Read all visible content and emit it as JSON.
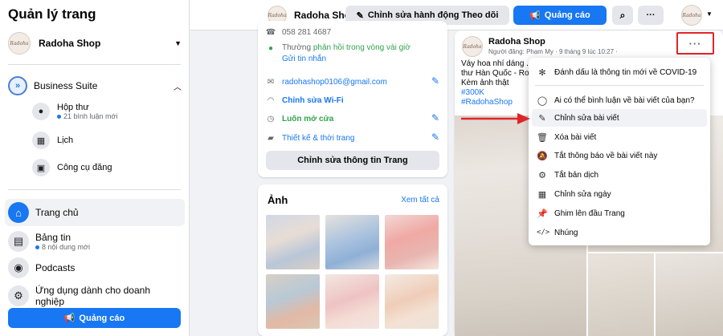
{
  "sidebar": {
    "title": "Quản lý trang",
    "page_name": "Radoha Shop",
    "business_suite": "Business Suite",
    "items": [
      {
        "label": "Hộp thư",
        "sub": "21 bình luận mới"
      },
      {
        "label": "Lịch",
        "sub": ""
      },
      {
        "label": "Công cụ đăng",
        "sub": ""
      }
    ],
    "nav": [
      {
        "label": "Trang chủ",
        "sub": ""
      },
      {
        "label": "Bảng tin",
        "sub": "8 nội dung mới"
      },
      {
        "label": "Podcasts",
        "sub": ""
      },
      {
        "label": "Ứng dụng dành cho doanh nghiệp",
        "sub": ""
      }
    ],
    "ad_button": "Quảng cáo"
  },
  "header": {
    "page_name": "Radoha Shop",
    "edit_action": "Chỉnh sửa hành động Theo dõi",
    "ad_button": "Quảng cáo"
  },
  "info_card": {
    "phone_partial": "058 281 4687",
    "response_prefix": "Thường",
    "response_link": "phản hồi trong vòng vài giờ",
    "message_link": "Gửi tin nhắn",
    "email": "radohashop0106@gmail.com",
    "wifi": "Chỉnh sửa Wi-Fi",
    "open": "Luôn mở cửa",
    "category": "Thiết kế & thời trang",
    "edit_button": "Chỉnh sửa thông tin Trang"
  },
  "photos_card": {
    "title": "Ảnh",
    "see_all": "Xem tất cả"
  },
  "post": {
    "author": "Radoha Shop",
    "meta": "Người đăng: Phạm My · 9 tháng 9 lúc 10:27 ·",
    "text_lines": [
      "Váy hoa nhí dáng ...",
      "thư Hàn Quốc - Ro...",
      "Kèm ảnh thật"
    ],
    "price": "#300K",
    "tag": "#RadohaShop",
    "more_icon": "ellipsis-icon"
  },
  "menu": {
    "items": [
      {
        "label": "Đánh dấu là thông tin mới về COVID-19",
        "icon": "covid-icon"
      },
      {
        "label": "Ai có thể bình luận về bài viết của bạn?",
        "icon": "comment-icon"
      },
      {
        "label": "Chỉnh sửa bài viết",
        "icon": "pencil-icon"
      },
      {
        "label": "Xóa bài viết",
        "icon": "trash-icon"
      },
      {
        "label": "Tắt thông báo về bài viết này",
        "icon": "bell-off-icon"
      },
      {
        "label": "Tắt bản dịch",
        "icon": "translate-icon"
      },
      {
        "label": "Chỉnh sửa ngày",
        "icon": "calendar-icon"
      },
      {
        "label": "Ghim lên đầu Trang",
        "icon": "pin-icon"
      },
      {
        "label": "Nhúng",
        "icon": "code-icon"
      }
    ]
  },
  "colors": {
    "accent": "#1877f2",
    "highlight_border": "#e0252a",
    "arrow": "#e0252a",
    "open_green": "#31a24c"
  }
}
